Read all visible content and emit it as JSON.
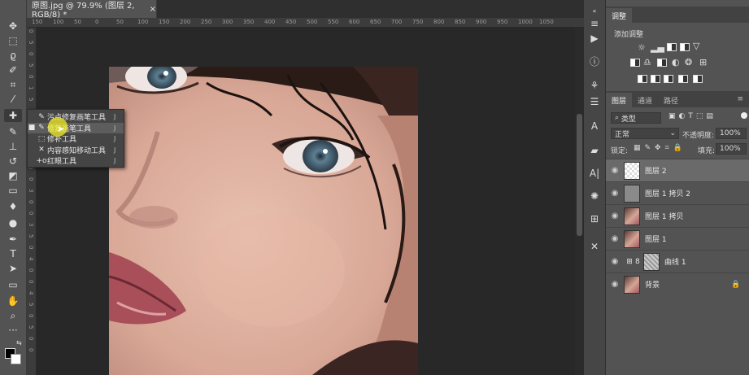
{
  "document": {
    "tab_title": "原图.jpg @ 79.9% (图层 2, RGB/8) *",
    "close_symbol": "×"
  },
  "ruler": {
    "horizontal": [
      "150",
      "100",
      "50",
      "0",
      "50",
      "100",
      "150",
      "200",
      "250",
      "300",
      "350",
      "400",
      "450",
      "500",
      "550",
      "600",
      "650",
      "700",
      "750",
      "800",
      "850",
      "900",
      "950",
      "1000",
      "1050"
    ],
    "vertical": [
      "0",
      "5",
      "0",
      "5",
      "0",
      "1",
      "5",
      "0",
      "2",
      "0",
      "0",
      "2",
      "5",
      "0",
      "3",
      "0",
      "0",
      "3",
      "5",
      "0",
      "4",
      "0",
      "0",
      "4",
      "5",
      "0",
      "5",
      "0",
      "0"
    ]
  },
  "flyout": {
    "items": [
      {
        "label": "污点修复画笔工具",
        "key": "J",
        "icon": "spot-healing-icon",
        "glyph": "✎",
        "selected": false,
        "marker": ""
      },
      {
        "label": "修复画笔工具",
        "key": "J",
        "icon": "healing-brush-icon",
        "glyph": "✎",
        "selected": true,
        "marker": "■"
      },
      {
        "label": "修补工具",
        "key": "J",
        "icon": "patch-icon",
        "glyph": "⬚",
        "selected": false,
        "marker": ""
      },
      {
        "label": "内容感知移动工具",
        "key": "J",
        "icon": "content-aware-move-icon",
        "glyph": "✕",
        "selected": false,
        "marker": ""
      },
      {
        "label": "红眼工具",
        "key": "J",
        "icon": "red-eye-icon",
        "glyph": "+o",
        "selected": false,
        "marker": ""
      }
    ]
  },
  "panels": {
    "adjustments": {
      "tab": "调整",
      "add_label": "添加调整"
    },
    "layers_tabs": [
      "图层",
      "通道",
      "路径"
    ],
    "filter_kind": "类型",
    "blend_mode": "正常",
    "opacity_label": "不透明度:",
    "opacity_value": "100%",
    "lock_label": "锁定:",
    "fill_label": "填充:",
    "fill_value": "100%"
  },
  "layers": [
    {
      "name": "图层 2",
      "selected": true,
      "thumb": "transparent"
    },
    {
      "name": "图层 1 拷贝 2",
      "selected": false,
      "thumb": "gray"
    },
    {
      "name": "图层 1 拷贝",
      "selected": false,
      "thumb": "face"
    },
    {
      "name": "图层 1",
      "selected": false,
      "thumb": "face"
    },
    {
      "name": "曲线 1",
      "selected": false,
      "thumb": "curves"
    },
    {
      "name": "背景",
      "selected": false,
      "thumb": "face",
      "locked": true
    }
  ],
  "colors": {
    "ui_dark": "#282828",
    "panel": "#535353",
    "selected_layer": "#6a6a6a",
    "cursor_highlight": "#f0eb28"
  }
}
